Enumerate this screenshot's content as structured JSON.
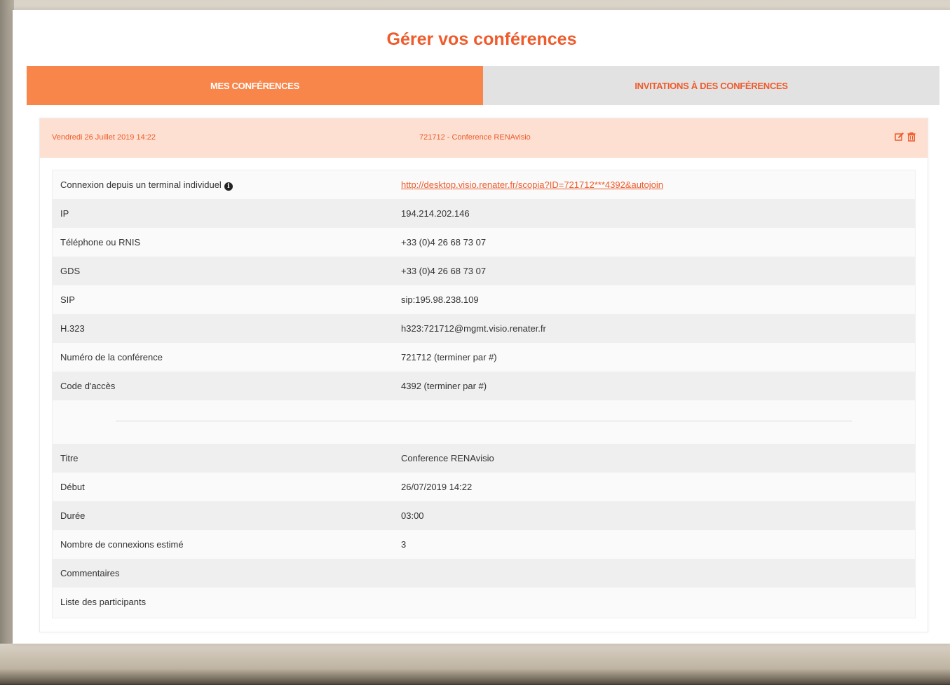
{
  "page": {
    "title": "Gérer vos conférences"
  },
  "tabs": [
    {
      "label": "MES CONFÉRENCES",
      "active": true
    },
    {
      "label": "INVITATIONS À DES CONFÉRENCES",
      "active": false
    }
  ],
  "conference": {
    "date": "Vendredi 26 Juillet 2019 14:22",
    "name": "721712 - Conference RENAvisio",
    "actions": [
      {
        "icon": "edit-icon"
      },
      {
        "icon": "trash-icon"
      }
    ],
    "connection_rows": [
      {
        "label": "Connexion depuis un terminal individuel",
        "value": "http://desktop.visio.renater.fr/scopia?ID=721712***4392&autojoin",
        "is_link": true,
        "info_icon": "info-icon"
      },
      {
        "label": "IP",
        "value": "194.214.202.146"
      },
      {
        "label": "Téléphone ou RNIS",
        "value": "+33 (0)4 26 68 73 07"
      },
      {
        "label": "GDS",
        "value": "+33 (0)4 26 68 73 07"
      },
      {
        "label": "SIP",
        "value": "sip:195.98.238.109"
      },
      {
        "label": "H.323",
        "value": "h323:721712@mgmt.visio.renater.fr"
      },
      {
        "label": "Numéro de la conférence",
        "value": "721712 (terminer par #)"
      },
      {
        "label": "Code d'accès",
        "value": "4392 (terminer par #)"
      }
    ],
    "info_rows": [
      {
        "label": "Titre",
        "value": "Conference RENAvisio"
      },
      {
        "label": "Début",
        "value": "26/07/2019 14:22"
      },
      {
        "label": "Durée",
        "value": "03:00"
      },
      {
        "label": "Nombre de connexions estimé",
        "value": "3"
      },
      {
        "label": "Commentaires",
        "value": ""
      },
      {
        "label": "Liste des participants",
        "value": ""
      }
    ]
  },
  "colors": {
    "accent": "#ef5b2b",
    "tab_active_bg": "#f8864a",
    "header_bg": "#fde0d2"
  }
}
